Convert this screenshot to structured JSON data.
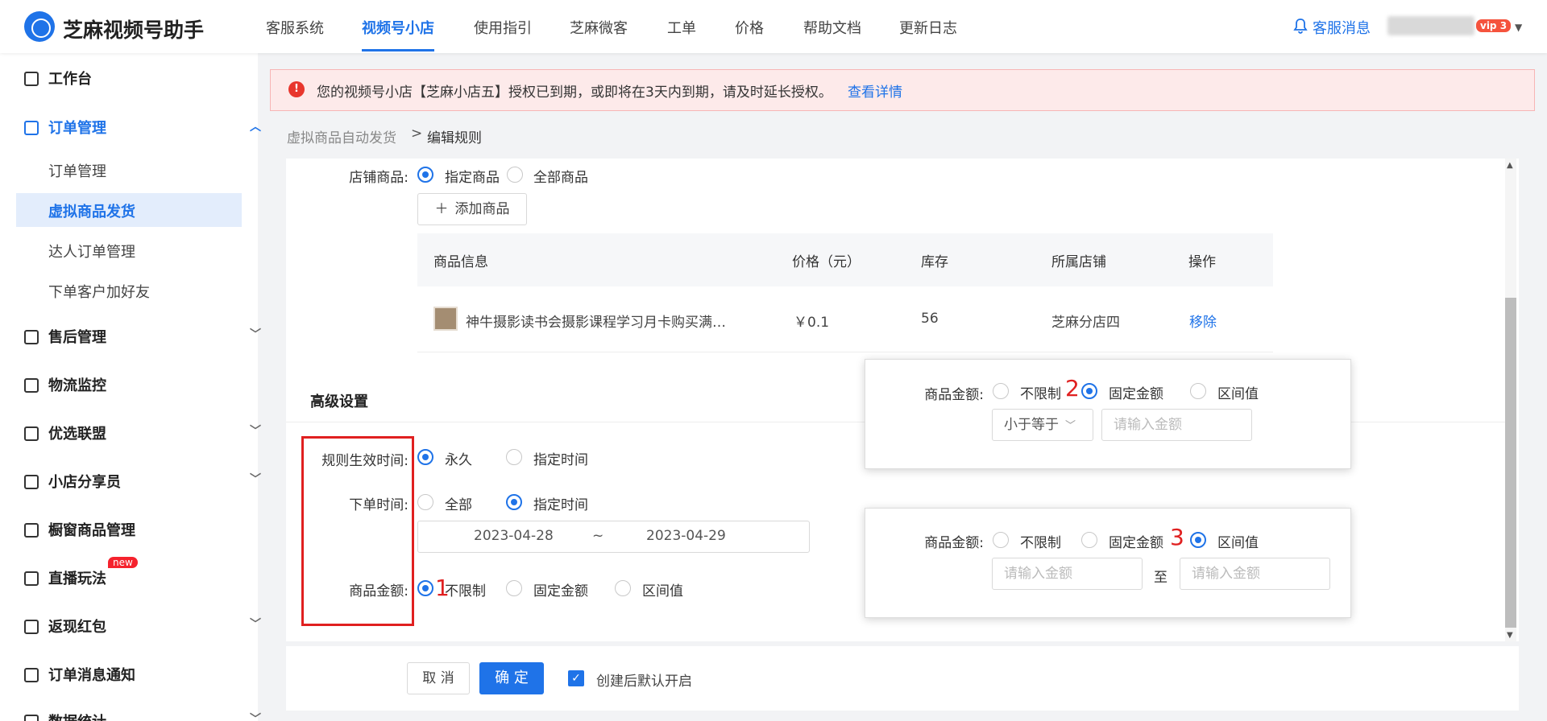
{
  "header": {
    "brand": "芝麻视频号助手",
    "nav": [
      "客服系统",
      "视频号小店",
      "使用指引",
      "芝麻微客",
      "工单",
      "价格",
      "帮助文档",
      "更新日志"
    ],
    "active_nav": "视频号小店",
    "notice": "客服消息",
    "vip_badge": "vip 3"
  },
  "sidebar": {
    "items": [
      {
        "label": "工作台",
        "icon": "monitor-icon"
      },
      {
        "label": "订单管理",
        "icon": "clipboard-icon",
        "open": true,
        "children": [
          "订单管理",
          "虚拟商品发货",
          "达人订单管理",
          "下单客户加好友"
        ],
        "active_child": "虚拟商品发货"
      },
      {
        "label": "售后管理",
        "icon": "service-icon"
      },
      {
        "label": "物流监控",
        "icon": "truck-icon"
      },
      {
        "label": "优选联盟",
        "icon": "shield-icon"
      },
      {
        "label": "小店分享员",
        "icon": "share-icon"
      },
      {
        "label": "橱窗商品管理",
        "icon": "window-icon"
      },
      {
        "label": "直播玩法",
        "icon": "play-icon",
        "badge": "new"
      },
      {
        "label": "返现红包",
        "icon": "redpacket-icon"
      },
      {
        "label": "订单消息通知",
        "icon": "bell-icon"
      },
      {
        "label": "数据统计",
        "icon": "chart-icon"
      }
    ]
  },
  "alert": {
    "text": "您的视频号小店【芝麻小店五】授权已到期，或即将在3天内到期，请及时延长授权。",
    "link": "查看详情",
    "color": "#e8362d"
  },
  "breadcrumb": {
    "parent": "虚拟商品自动发货",
    "current": "编辑规则"
  },
  "form": {
    "shop_goods_label": "店铺商品:",
    "shop_goods_options": [
      "指定商品",
      "全部商品"
    ],
    "add_goods_button": "添加商品",
    "table": {
      "headers": [
        "商品信息",
        "价格（元）",
        "库存",
        "所属店铺",
        "操作"
      ],
      "rows": [
        {
          "name": "神牛摄影读书会摄影课程学习月卡购买满…",
          "price": "￥0.1",
          "stock": "56",
          "shop": "芝麻分店四",
          "action": "移除"
        }
      ]
    },
    "advanced_title": "高级设置",
    "effective_label": "规则生效时间:",
    "effective_options": [
      "永久",
      "指定时间"
    ],
    "order_time_label": "下单时间:",
    "order_time_options": [
      "全部",
      "指定时间"
    ],
    "date_start": "2023-04-28",
    "date_sep": "~",
    "date_end": "2023-04-29",
    "amount_label": "商品金额:",
    "amount_options": [
      "不限制",
      "固定金额",
      "区间值"
    ]
  },
  "popup_fixed": {
    "label": "商品金额:",
    "options": [
      "不限制",
      "固定金额",
      "区间值"
    ],
    "compare_select": "小于等于",
    "amount_placeholder": "请输入金额"
  },
  "popup_range": {
    "label": "商品金额:",
    "options": [
      "不限制",
      "固定金额",
      "区间值"
    ],
    "min_placeholder": "请输入金额",
    "to": "至",
    "max_placeholder": "请输入金额"
  },
  "markers": [
    "1",
    "2",
    "3"
  ],
  "footer": {
    "cancel": "取 消",
    "ok": "确 定",
    "auto_enable": "创建后默认开启"
  },
  "colors": {
    "primary": "#1f73e8",
    "alert_bg": "#fdeaea",
    "annotation": "#e02020"
  }
}
